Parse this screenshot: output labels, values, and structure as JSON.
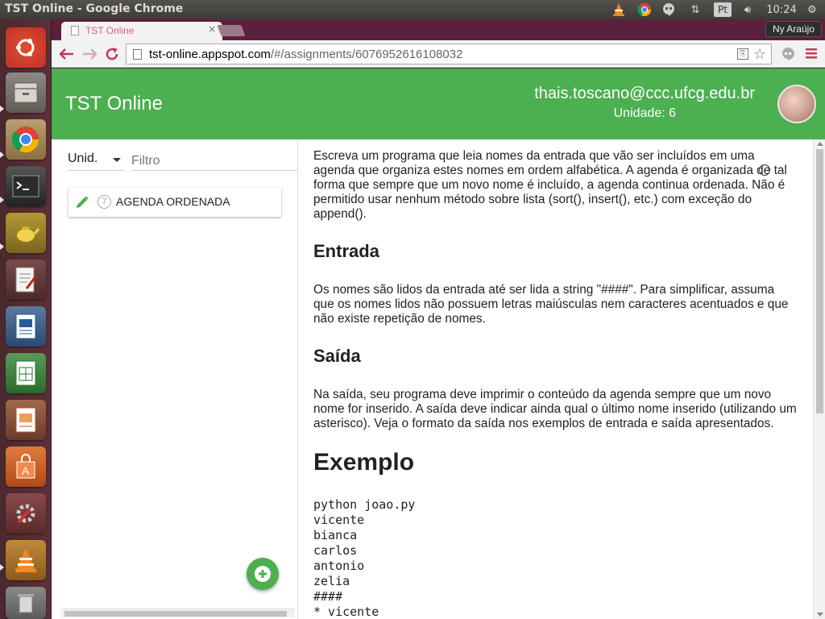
{
  "os_panel": {
    "window_title": "TST Online - Google Chrome",
    "clock": "10:24",
    "language_indicator": "Pt",
    "icons": [
      "vlc-icon",
      "chrome-icon",
      "hangouts-icon",
      "network-icon",
      "keyboard-icon",
      "volume-icon",
      "gear-icon"
    ]
  },
  "launcher": {
    "items": [
      "ubuntu-dash",
      "files",
      "chrome",
      "terminal",
      "teapot",
      "text-editor",
      "writer",
      "calc",
      "impress",
      "software-center",
      "system-settings",
      "vlc",
      "trash"
    ]
  },
  "browser": {
    "tab_title": "TST Online",
    "tab_close": "×",
    "profile_name": "Ny Araújo",
    "url_host": "tst-online.appspot.com",
    "url_path": "/#/assignments/6076952616108032"
  },
  "app": {
    "title": "TST Online",
    "user_email": "thais.toscano@ccc.ufcg.edu.br",
    "user_unit": "Unidade: 6",
    "sidebar": {
      "unit_select": "Unid.",
      "filter_placeholder": "Filtro",
      "assignments": [
        {
          "count": "7",
          "title": "AGENDA ORDENADA"
        }
      ]
    },
    "document": {
      "intro": "Escreva um programa que leia nomes da entrada que vão ser incluídos em uma agenda que organiza estes nomes em ordem alfabética. A agenda é organizada de tal forma que sempre que um novo nome é incluído, a agenda continua ordenada. Não é permitido usar nenhum método sobre lista (sort(), insert(), etc.) com exceção do append().",
      "entrada_heading": "Entrada",
      "entrada_text": "Os nomes são lidos da entrada até ser lida a string \"####\". Para simplificar, assuma que os nomes lidos não possuem letras maiúsculas nem caracteres acentuados e que não existe repetição de nomes.",
      "saida_heading": "Saída",
      "saida_text": "Na saída, seu programa deve imprimir o conteúdo da agenda sempre que um novo nome for inserido. A saída deve indicar ainda qual o último nome inserido (utilizando um asterisco). Veja o formato da saída nos exemplos de entrada e saída apresentados.",
      "exemplo_heading": "Exemplo",
      "code": "python joao.py\nvicente\nbianca\ncarlos\nantonio\nzelia\n####\n* vicente"
    }
  },
  "colors": {
    "app_green": "#4caf50",
    "chrome_frame": "#5a1f3a",
    "tab_title": "#e05a7a"
  }
}
